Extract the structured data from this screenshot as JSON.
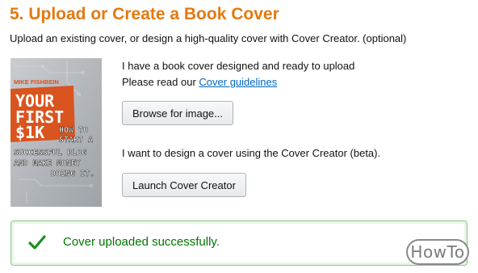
{
  "section": {
    "title": "5. Upload or Create a Book Cover",
    "subtitle": "Upload an existing cover, or design a high-quality cover with Cover Creator. (optional)"
  },
  "book": {
    "author": "MIKE FISHBEIN",
    "title_line1": "YOUR",
    "title_line2": "FIRST",
    "title_line3": "$1K",
    "subtitle_lines": [
      "HOW TO",
      "START A",
      "SUCCESSFUL BLOG",
      "AND MAKE MONEY",
      "DOING IT."
    ],
    "accent_color": "#d9541e"
  },
  "upload": {
    "line1": "I have a book cover designed and ready to upload",
    "line2_prefix": "Please read our ",
    "guidelines_link": "Cover guidelines",
    "browse_label": "Browse for image..."
  },
  "creator": {
    "description": "I want to design a cover using the Cover Creator (beta).",
    "launch_label": "Launch Cover Creator"
  },
  "status": {
    "message": "Cover uploaded successfully.",
    "color": "#007600",
    "icon": "checkmark-icon"
  },
  "watermark": {
    "text": "HowTo"
  }
}
